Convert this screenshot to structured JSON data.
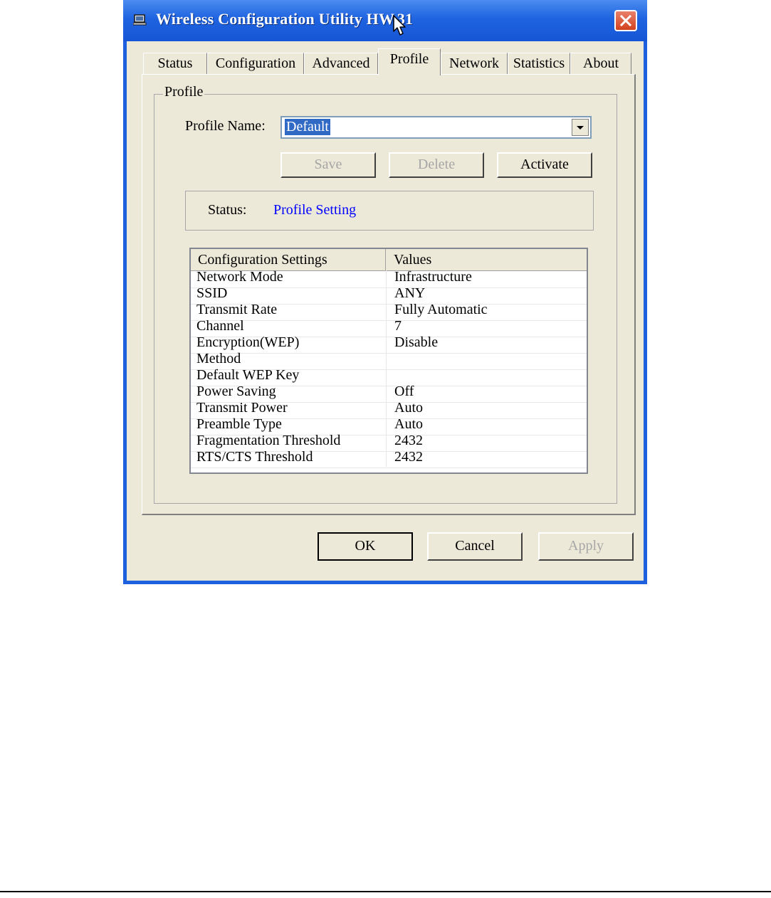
{
  "window": {
    "title": "Wireless Configuration Utility HW.31"
  },
  "tabs": [
    "Status",
    "Configuration",
    "Advanced",
    "Profile",
    "Network",
    "Statistics",
    "About"
  ],
  "active_tab": "Profile",
  "profile": {
    "group_label": "Profile",
    "name_label": "Profile Name:",
    "name_value": "Default",
    "buttons": {
      "save": "Save",
      "delete": "Delete",
      "activate": "Activate"
    },
    "status_label": "Status:",
    "status_value": "Profile Setting",
    "status_color": "#0000ff"
  },
  "settings_table": {
    "headers": [
      "Configuration Settings",
      "Values"
    ],
    "rows": [
      [
        "Network Mode",
        "Infrastructure"
      ],
      [
        "SSID",
        "ANY"
      ],
      [
        "Transmit Rate",
        "Fully Automatic"
      ],
      [
        "Channel",
        "7"
      ],
      [
        "Encryption(WEP)",
        "Disable"
      ],
      [
        "Method",
        ""
      ],
      [
        "Default WEP Key",
        ""
      ],
      [
        "Power Saving",
        "Off"
      ],
      [
        "Transmit Power",
        "Auto"
      ],
      [
        "Preamble Type",
        "Auto"
      ],
      [
        "Fragmentation Threshold",
        "2432"
      ],
      [
        "RTS/CTS Threshold",
        "2432"
      ]
    ]
  },
  "dialog_buttons": {
    "ok": "OK",
    "cancel": "Cancel",
    "apply": "Apply"
  },
  "icons": {
    "app": "network-computer-icon",
    "close": "close-icon",
    "dropdown": "chevron-down-icon",
    "cursor": "mouse-pointer-icon"
  }
}
